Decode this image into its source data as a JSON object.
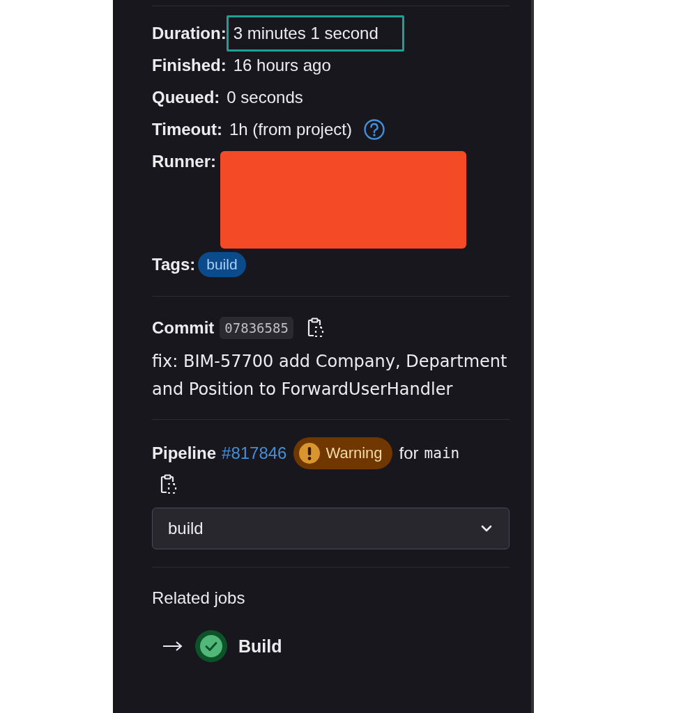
{
  "details": [
    {
      "label": "Duration:",
      "kind": "text",
      "value": "3 minutes 1 second",
      "highlighted": true
    },
    {
      "label": "Finished:",
      "kind": "text",
      "value": "16 hours ago",
      "highlighted": false
    },
    {
      "label": "Queued:",
      "kind": "text",
      "value": "0 seconds",
      "highlighted": false
    },
    {
      "label": "Timeout:",
      "kind": "help",
      "value": "1h (from project)",
      "highlighted": false
    },
    {
      "label": "Runner:",
      "kind": "redacted"
    },
    {
      "label": "Tags:",
      "kind": "tags",
      "tags": [
        "build"
      ]
    }
  ],
  "commit": {
    "label": "Commit",
    "sha": "07836585",
    "message": "fix: BIM-57700 add Company, Department and Position to ForwardUserHandler"
  },
  "pipeline": {
    "label": "Pipeline",
    "link": "#817846",
    "status": "Warning",
    "kind": "warning",
    "for_text": "for",
    "ref": "main"
  },
  "stage_dropdown": {
    "value": "build"
  },
  "related_jobs": {
    "title": "Related jobs",
    "jobs": [
      {
        "name": "Build",
        "kind": "success",
        "current": true
      }
    ]
  }
}
